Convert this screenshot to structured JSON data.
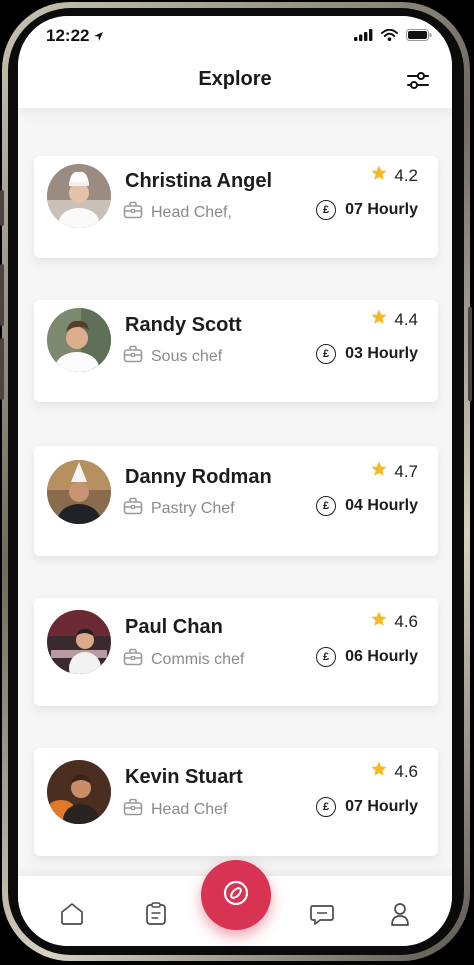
{
  "status_bar": {
    "time": "12:22"
  },
  "header": {
    "title": "Explore"
  },
  "chefs": [
    {
      "name": "Christina Angel",
      "role": "Head Chef,",
      "rating": "4.2",
      "rate": "07 Hourly"
    },
    {
      "name": "Randy Scott",
      "role": "Sous chef",
      "rating": "4.4",
      "rate": "03 Hourly"
    },
    {
      "name": "Danny Rodman",
      "role": "Pastry Chef",
      "rating": "4.7",
      "rate": "04 Hourly"
    },
    {
      "name": "Paul Chan",
      "role": "Commis chef",
      "rating": "4.6",
      "rate": "06 Hourly"
    },
    {
      "name": "Kevin Stuart",
      "role": "Head Chef",
      "rating": "4.6",
      "rate": "07 Hourly"
    }
  ],
  "currency_symbol": "£",
  "icons": {
    "filter": "filter-sliders-icon",
    "role": "briefcase-icon",
    "rating": "star-icon",
    "rate": "pound-icon",
    "tabs": [
      "home-icon",
      "clipboard-icon",
      "compass-icon",
      "chat-icon",
      "profile-icon"
    ]
  },
  "colors": {
    "accent": "#d83353",
    "star": "#f6b91e",
    "muted_text": "#8a8a8a"
  }
}
